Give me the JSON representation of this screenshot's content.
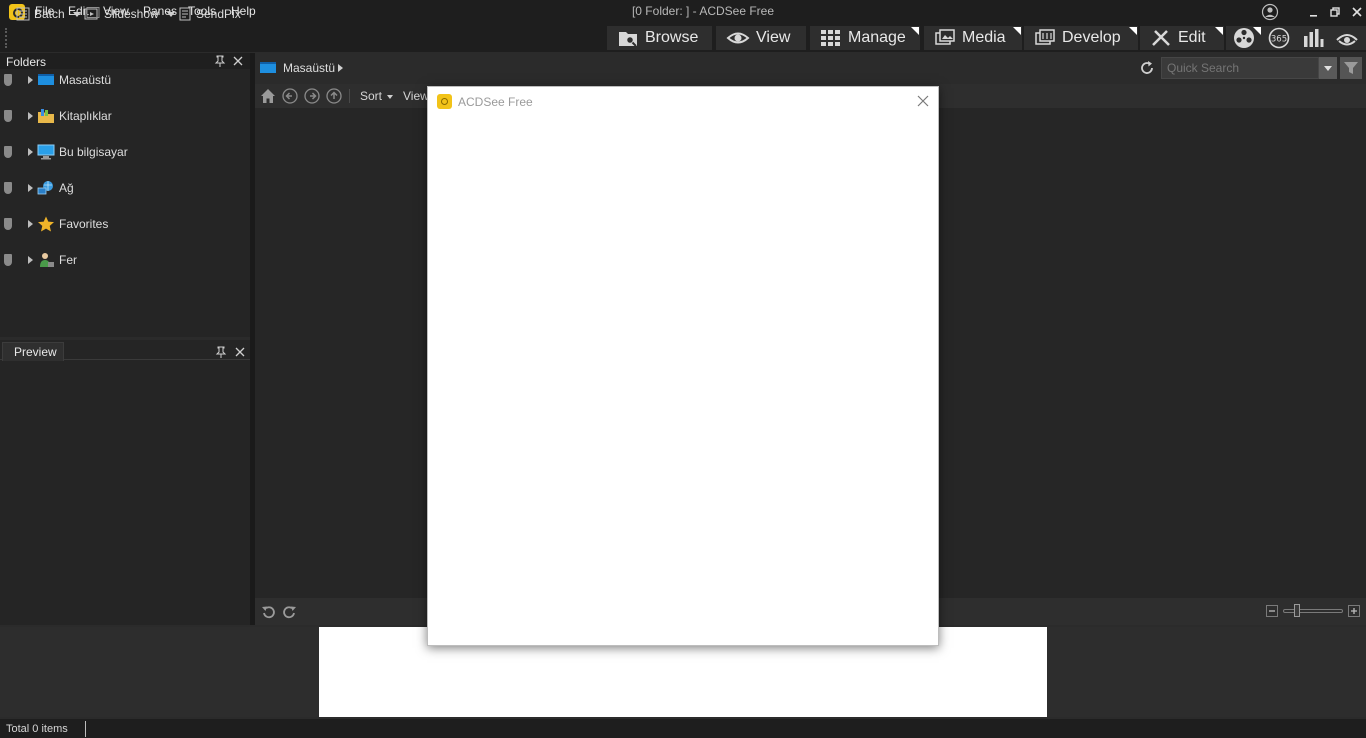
{
  "window": {
    "title": "[0 Folder: ] - ACDSee Free"
  },
  "menu": [
    "File",
    "Edit",
    "View",
    "Panes",
    "Tools",
    "Help"
  ],
  "toolbar": {
    "batch": "Batch",
    "slideshow": "Slideshow",
    "sendpix": "SendPix"
  },
  "modes": [
    "Browse",
    "View",
    "Manage",
    "Media",
    "Develop",
    "Edit"
  ],
  "folders_panel": {
    "tab": "Folders",
    "items": [
      "Masaüstü",
      "Kitaplıklar",
      "Bu bilgisayar",
      "Ağ",
      "Favorites",
      "Fer"
    ]
  },
  "preview_panel": {
    "tab": "Preview"
  },
  "address": {
    "path": "Masaüstü",
    "quick_search_placeholder": "Quick Search"
  },
  "nav": {
    "sort": "Sort",
    "view": "View"
  },
  "status": {
    "text": "Total 0 items"
  },
  "dialog": {
    "title": "ACDSee Free"
  },
  "colors": {
    "accent": "#f2c318",
    "background": "#2b2b2b"
  }
}
